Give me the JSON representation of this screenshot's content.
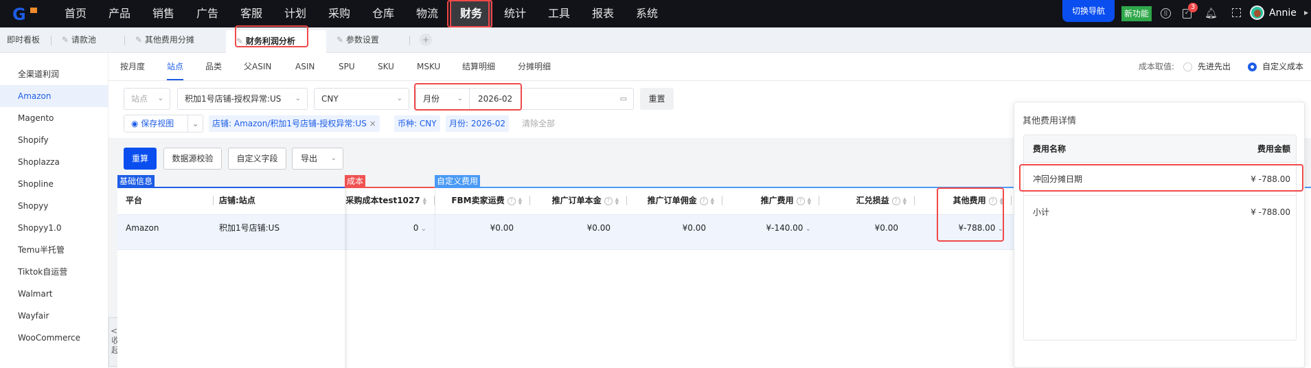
{
  "nav": {
    "items": [
      "首页",
      "产品",
      "销售",
      "广告",
      "客服",
      "计划",
      "采购",
      "仓库",
      "物流",
      "财务",
      "统计",
      "工具",
      "报表",
      "系统"
    ],
    "active": "财务",
    "switch_nav": "切换导航",
    "new_feature": "新功能",
    "badge_count": "3",
    "user": "Annie"
  },
  "tabs": [
    {
      "label": "即时看板"
    },
    {
      "label": "请款池"
    },
    {
      "label": "其他费用分摊"
    },
    {
      "label": "财务利润分析"
    },
    {
      "label": "参数设置"
    }
  ],
  "tab_add": "+",
  "sidebar": {
    "items": [
      "全渠道利润",
      "Amazon",
      "Magento",
      "Shopify",
      "Shoplazza",
      "Shopline",
      "Shopyy",
      "Shopyy1.0",
      "Temu半托管",
      "Tiktok自运营",
      "Walmart",
      "Wayfair",
      "WooCommerce"
    ],
    "active": "Amazon",
    "collapse_label": "收起"
  },
  "subtabs": {
    "items": [
      "按月度",
      "站点",
      "品类",
      "父ASIN",
      "ASIN",
      "SPU",
      "SKU",
      "MSKU",
      "结算明细",
      "分摊明细"
    ],
    "active": "站点"
  },
  "cost_mode": {
    "label": "成本取值:",
    "options": [
      "先进先出",
      "自定义成本"
    ],
    "selected": "自定义成本"
  },
  "filters": {
    "site_placeholder": "站点",
    "store": "积加1号店铺-授权异常:US",
    "currency": "CNY",
    "period_type": "月份",
    "month": "2026-02",
    "reset": "重置"
  },
  "chips": {
    "save_view": "保存视图",
    "items": [
      "店铺: Amazon/积加1号店铺-授权异常:US",
      "币种: CNY",
      "月份: 2026-02"
    ],
    "clear_all": "清除全部"
  },
  "toolbar": {
    "recalc": "重算",
    "validate": "数据源校验",
    "custom_fields": "自定义字段",
    "export": "导出"
  },
  "table": {
    "groups": [
      {
        "label": "基础信息",
        "color": "#1d5ce6"
      },
      {
        "label": "成本",
        "color": "#f05252"
      },
      {
        "label": "自定义费用",
        "color": "#4a9af5"
      }
    ],
    "columns": [
      "平台",
      "店铺:站点",
      "采购成本test1027",
      "FBM卖家运费",
      "推广订单本金",
      "推广订单佣金",
      "推广费用",
      "汇兑损益",
      "其他费用"
    ],
    "rows": [
      [
        "Amazon",
        "积加1号店铺:US",
        "0",
        "¥0.00",
        "¥0.00",
        "¥0.00",
        "¥-140.00",
        "¥0.00",
        "¥-788.00"
      ]
    ]
  },
  "popover": {
    "title": "其他费用详情",
    "headers": [
      "费用名称",
      "费用金额"
    ],
    "rows": [
      {
        "name": "冲回分摊日期",
        "amount": "¥ -788.00"
      }
    ],
    "subtotal": {
      "name": "小计",
      "amount": "¥ -788.00"
    }
  }
}
